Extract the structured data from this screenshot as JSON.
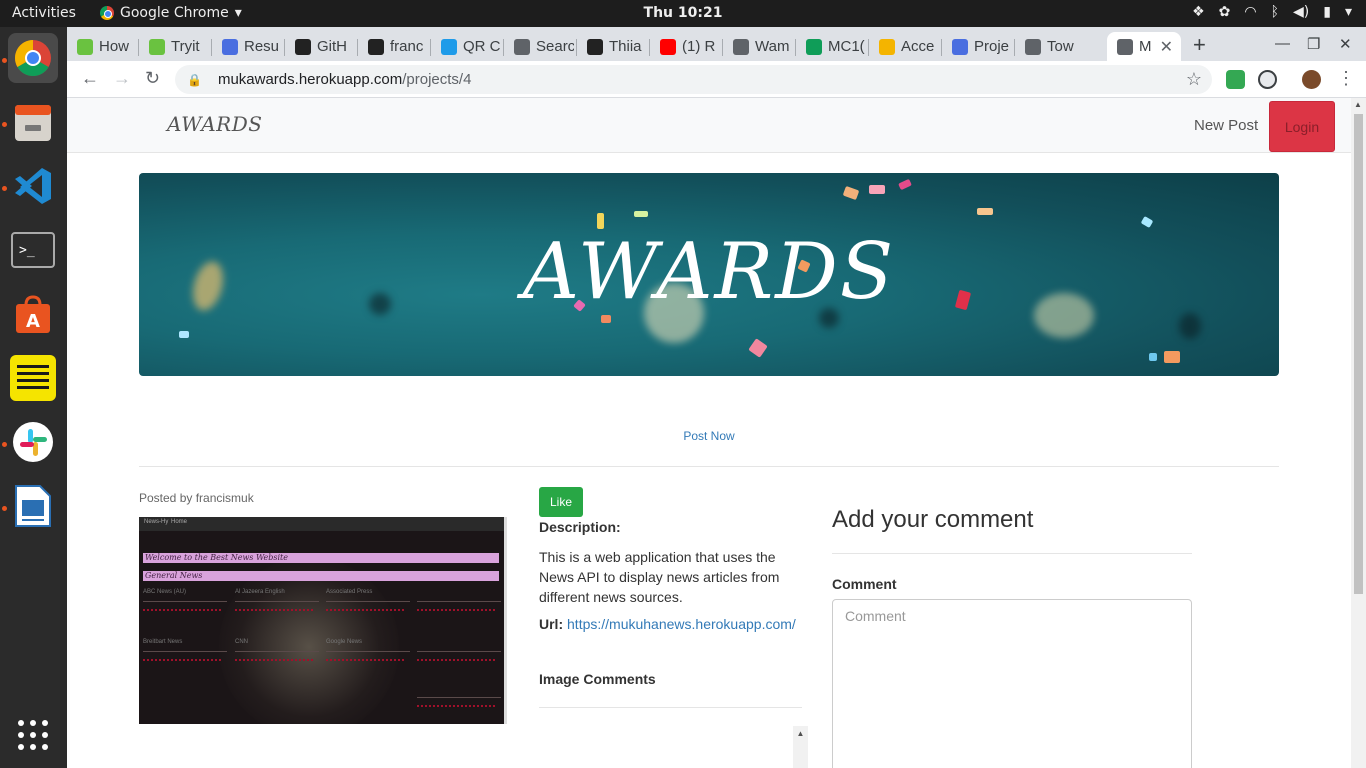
{
  "system_bar": {
    "activities": "Activities",
    "app_name": "Google Chrome",
    "app_menu_arrow": "▾",
    "clock": "Thu 10:21"
  },
  "tabs": [
    {
      "label": "How",
      "favicon_color": "#6ac240"
    },
    {
      "label": "Tryit",
      "favicon_color": "#6ac240"
    },
    {
      "label": "Resu",
      "favicon_color": "#4a6ee0"
    },
    {
      "label": "GitH",
      "favicon_color": "#222222"
    },
    {
      "label": "franc",
      "favicon_color": "#222222"
    },
    {
      "label": "QR C",
      "favicon_color": "#1e9be9"
    },
    {
      "label": "Searc",
      "favicon_color": "#5f6368"
    },
    {
      "label": "Thiia",
      "favicon_color": "#222222"
    },
    {
      "label": "(1) R",
      "favicon_color": "#ff0000"
    },
    {
      "label": "Wam",
      "favicon_color": "#5f6368"
    },
    {
      "label": "MC1(",
      "favicon_color": "#0f9d58"
    },
    {
      "label": "Acce",
      "favicon_color": "#f4b400"
    },
    {
      "label": "Proje",
      "favicon_color": "#4a6ee0"
    },
    {
      "label": "Tow",
      "favicon_color": "#5f6368"
    },
    {
      "label": "M",
      "favicon_color": "#5f6368",
      "active": true
    }
  ],
  "browser": {
    "url_host": "mukawards.herokuapp.com",
    "url_path": "/projects/4"
  },
  "site": {
    "brand": "AWARDS",
    "nav_new_post": "New Post",
    "nav_login": "Login",
    "hero_title": "AWARDS",
    "post_now": "Post Now",
    "posted_by": "Posted by francismuk",
    "like_button": "Like",
    "description_label": "Description:",
    "description_text": "This is a web application that uses the News API to display news articles from different news sources.",
    "url_label": "Url:",
    "url_value": "https://mukuhanews.herokuapp.com/",
    "image_comments_heading": "Image Comments",
    "add_comment_heading": "Add your comment",
    "comment_label": "Comment",
    "comment_placeholder": "Comment",
    "comment_value": ""
  },
  "screenshot_preview": {
    "nav_items": [
      "News-Hy",
      "Home"
    ],
    "banner_1": "Welcome to the Best News Website",
    "banner_2": "General News",
    "sources": [
      "ABC News (AU)",
      "Al Jazeera English",
      "Associated Press",
      "Breitbart News",
      "CNN",
      "Google News"
    ]
  },
  "colors": {
    "login_button": "#dc3545",
    "like_button": "#28a745",
    "link": "#337ab7",
    "hero_background": "#186a75"
  }
}
